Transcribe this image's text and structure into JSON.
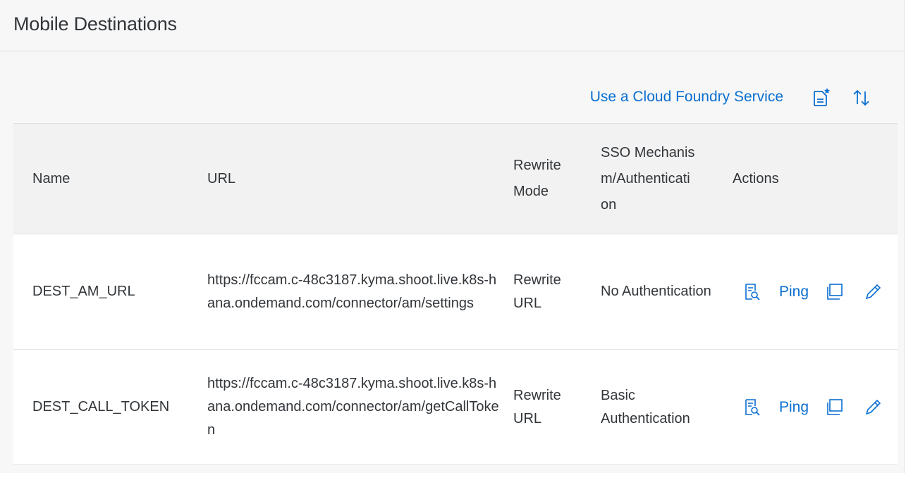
{
  "panel": {
    "title": "Mobile Destinations"
  },
  "toolbar": {
    "cf_link": "Use a Cloud Foundry Service",
    "create_icon": "create-document-icon",
    "sort_icon": "sort-icon"
  },
  "table": {
    "headers": {
      "name": "Name",
      "url": "URL",
      "rewrite": "Rewrite Mode",
      "sso": "SSO Mechanism/Authentication",
      "actions": "Actions"
    },
    "rows": [
      {
        "name": "DEST_AM_URL",
        "url": "https://fccam.c-48c3187.kyma.shoot.live.k8s-hana.ondemand.com/connector/am/settings",
        "rewrite": "Rewrite URL",
        "sso": "No Authentication",
        "ping": "Ping"
      },
      {
        "name": "DEST_CALL_TOKEN",
        "url": "https://fccam.c-48c3187.kyma.shoot.live.k8s-hana.ondemand.com/connector/am/getCallToken",
        "rewrite": "Rewrite URL",
        "sso": "Basic Authentication",
        "ping": "Ping"
      }
    ]
  },
  "colors": {
    "link": "#0a6ed1",
    "text": "#32363a",
    "panel_bg": "#f7f7f7",
    "header_bg": "#f2f2f2"
  }
}
